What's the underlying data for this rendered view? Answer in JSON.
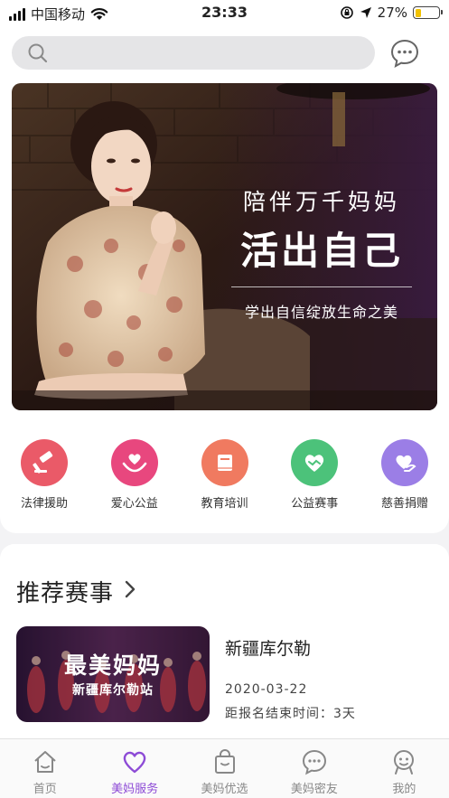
{
  "status_bar": {
    "carrier": "中国移动",
    "time": "23:33",
    "battery": "27%",
    "battery_level": 0.27
  },
  "search": {
    "placeholder": ""
  },
  "banner": {
    "line1": "陪伴万千妈妈",
    "line2": "活出自己",
    "line3": "学出自信绽放生命之美"
  },
  "categories": [
    {
      "label": "法律援助",
      "icon": "gavel-icon",
      "color": "#ea5a68"
    },
    {
      "label": "爱心公益",
      "icon": "heart-hands-icon",
      "color": "#e8477e"
    },
    {
      "label": "教育培训",
      "icon": "book-icon",
      "color": "#f07a60"
    },
    {
      "label": "公益赛事",
      "icon": "handshake-heart-icon",
      "color": "#4cc27a"
    },
    {
      "label": "慈善捐赠",
      "icon": "donate-heart-icon",
      "color": "#9b7ee6"
    }
  ],
  "recommend": {
    "title": "推荐赛事",
    "events": [
      {
        "banner_title": "最美妈妈",
        "banner_sub": "新疆库尔勒站",
        "name": "新疆库尔勒",
        "date": "2020-03-22",
        "deadline": "距报名结束时间：3天"
      }
    ]
  },
  "tabs": [
    {
      "label": "首页",
      "icon": "home-icon",
      "active": false
    },
    {
      "label": "美妈服务",
      "icon": "heart-icon",
      "active": true
    },
    {
      "label": "美妈优选",
      "icon": "shopping-bag-icon",
      "active": false
    },
    {
      "label": "美妈密友",
      "icon": "chat-bubble-icon",
      "active": false
    },
    {
      "label": "我的",
      "icon": "profile-icon",
      "active": false
    }
  ]
}
